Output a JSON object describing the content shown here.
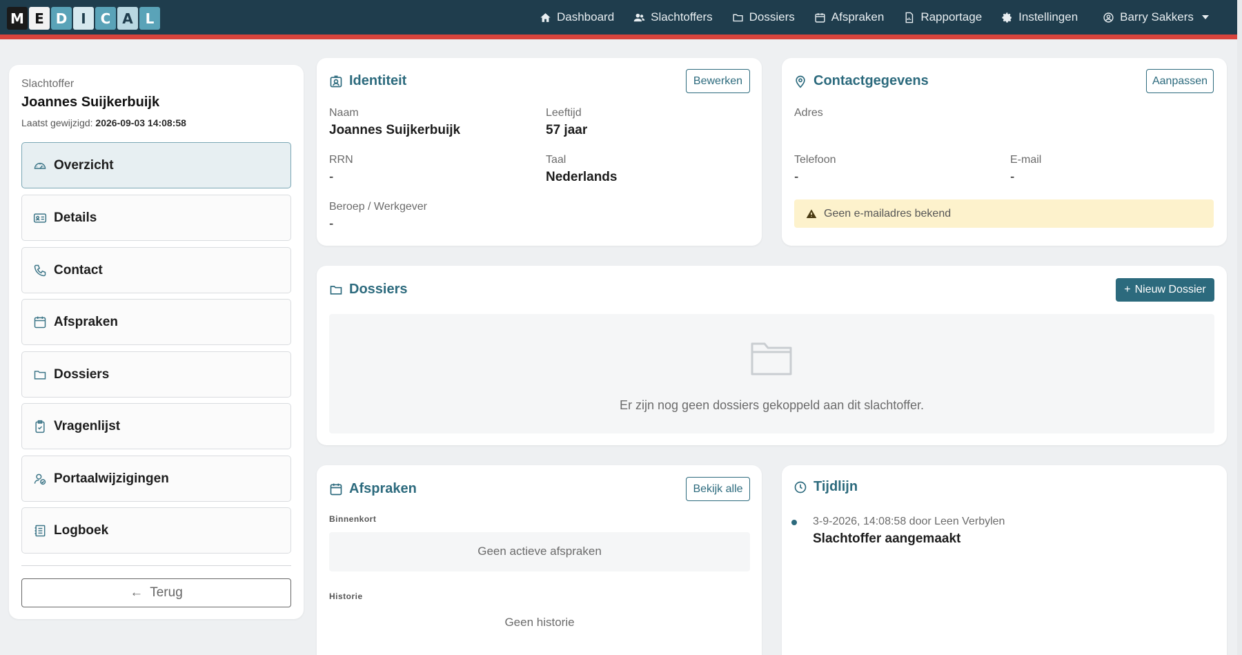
{
  "logo": {
    "letters": [
      "M",
      "E",
      "D",
      "I",
      "C",
      "A",
      "L"
    ]
  },
  "nav": {
    "items": [
      {
        "label": "Dashboard",
        "icon": "home-icon"
      },
      {
        "label": "Slachtoffers",
        "icon": "users-icon"
      },
      {
        "label": "Dossiers",
        "icon": "folder-icon"
      },
      {
        "label": "Afspraken",
        "icon": "calendar-icon"
      },
      {
        "label": "Rapportage",
        "icon": "report-icon"
      },
      {
        "label": "Instellingen",
        "icon": "gear-icon"
      }
    ],
    "user": "Barry Sakkers"
  },
  "sidebar": {
    "subtitle": "Slachtoffer",
    "name": "Joannes Suijkerbuijk",
    "modified_label": "Laatst gewijzigd:",
    "modified_value": "2026-09-03 14:08:58",
    "items": [
      {
        "label": "Overzicht",
        "icon": "gauge-icon",
        "active": true
      },
      {
        "label": "Details",
        "icon": "id-card-icon"
      },
      {
        "label": "Contact",
        "icon": "phone-icon"
      },
      {
        "label": "Afspraken",
        "icon": "calendar-icon"
      },
      {
        "label": "Dossiers",
        "icon": "folder-icon"
      },
      {
        "label": "Vragenlijst",
        "icon": "clipboard-check-icon"
      },
      {
        "label": "Portaalwijzigingen",
        "icon": "user-check-icon"
      },
      {
        "label": "Logboek",
        "icon": "logbook-icon"
      }
    ],
    "back_label": "Terug"
  },
  "identity": {
    "title": "Identiteit",
    "edit_label": "Bewerken",
    "naam_label": "Naam",
    "naam_value": "Joannes Suijkerbuijk",
    "leeftijd_label": "Leeftijd",
    "leeftijd_value": "57 jaar",
    "rrn_label": "RRN",
    "rrn_value": "-",
    "taal_label": "Taal",
    "taal_value": "Nederlands",
    "beroep_label": "Beroep / Werkgever",
    "beroep_value": "-"
  },
  "contact": {
    "title": "Contactgegevens",
    "edit_label": "Aanpassen",
    "adres_label": "Adres",
    "telefoon_label": "Telefoon",
    "telefoon_value": "-",
    "email_label": "E-mail",
    "email_value": "-",
    "warning": "Geen e-mailadres bekend"
  },
  "dossiers": {
    "title": "Dossiers",
    "new_label": "Nieuw Dossier",
    "empty_text": "Er zijn nog geen dossiers gekoppeld aan dit slachtoffer."
  },
  "appointments": {
    "title": "Afspraken",
    "view_all_label": "Bekijk alle",
    "upcoming_label": "Binnenkort",
    "upcoming_empty": "Geen actieve afspraken",
    "history_label": "Historie",
    "history_empty": "Geen historie"
  },
  "timeline": {
    "title": "Tijdlijn",
    "entries": [
      {
        "meta": "3-9-2026, 14:08:58 door Leen Verbylen",
        "text": "Slachtoffer aangemaakt"
      }
    ]
  },
  "colors": {
    "navbar": "#1f3d4d",
    "accent_line": "#d9443c",
    "primary": "#2c6a7d",
    "warning_bg": "#fdf2cc"
  }
}
